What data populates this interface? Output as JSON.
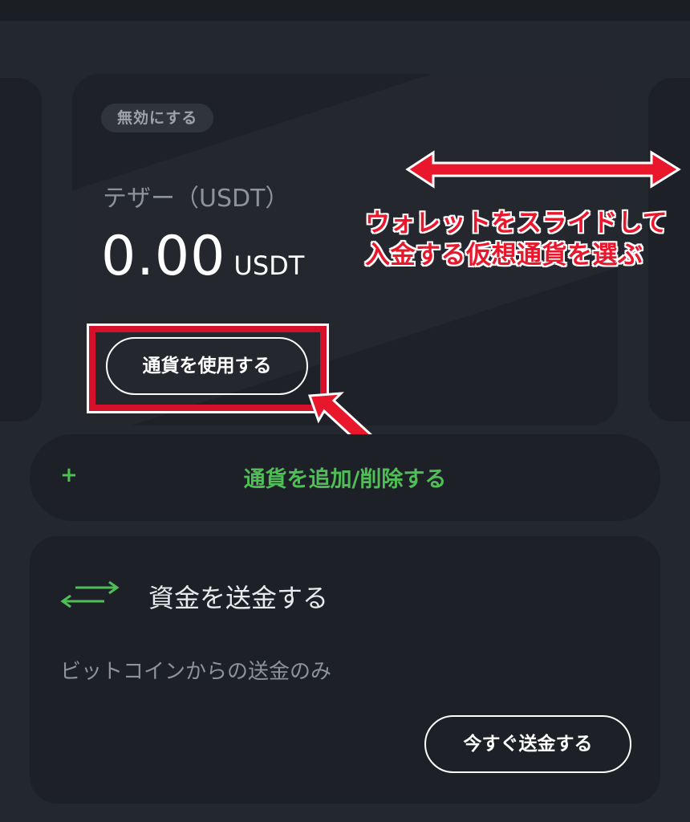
{
  "wallet_card": {
    "disable_label": "無効にする",
    "coin_name": "テザー（USDT）",
    "balance": "0.00",
    "unit": "USDT",
    "use_button_label": "通貨を使用する"
  },
  "annotation": {
    "line1": "ウォレットをスライドして",
    "line2": "入金する仮想通貨を選ぶ",
    "color": "#e8172c"
  },
  "add_currency": {
    "plus": "+",
    "label": "通貨を追加/削除する",
    "color": "#4fbe57"
  },
  "send_section": {
    "icon": "transfer-arrows-icon",
    "title": "資金を送金する",
    "note": "ビットコインからの送金のみ",
    "button_label": "今すぐ送金する"
  }
}
